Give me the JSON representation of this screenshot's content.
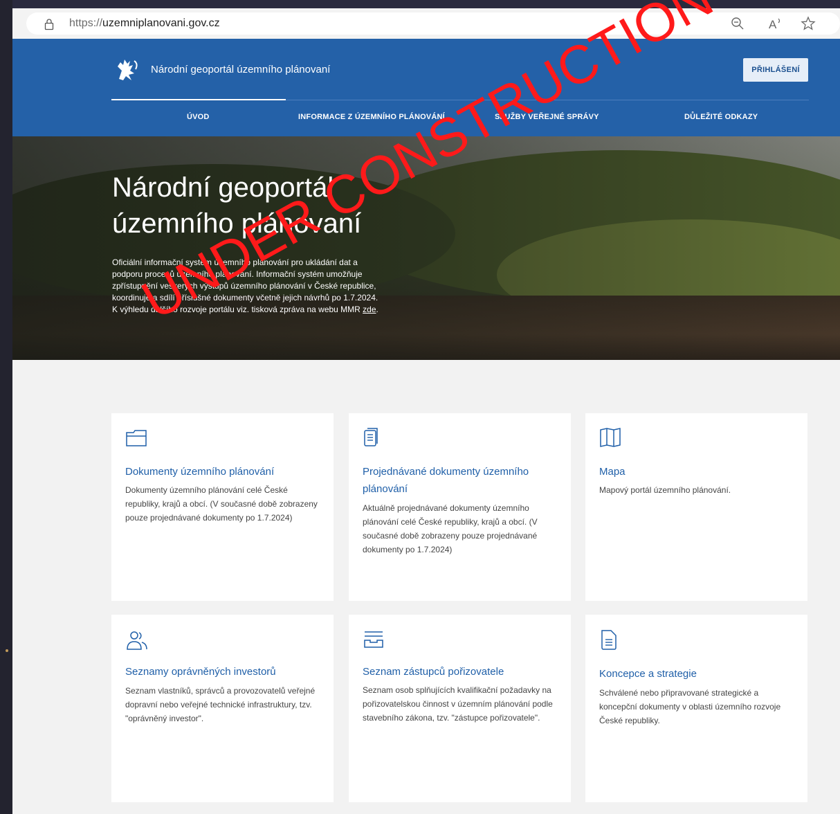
{
  "browser": {
    "url_scheme": "https://",
    "url_host": "uzemniplanovani.gov.cz",
    "icons": [
      "lock-icon",
      "zoom-out-icon",
      "read-aloud-icon",
      "favorite-star-icon"
    ]
  },
  "header": {
    "site_title": "Národní geoportál územního plánovaní",
    "login_label": "PŘIHLÁŠENÍ",
    "nav": [
      {
        "label": "ÚVOD",
        "active": true
      },
      {
        "label": "INFORMACE Z ÚZEMNÍHO PLÁNOVÁNÍ",
        "active": false
      },
      {
        "label": "SLUŽBY VEŘEJNÉ SPRÁVY",
        "active": false
      },
      {
        "label": "DŮLEŽITÉ ODKAZY",
        "active": false
      }
    ],
    "brand_color": "#2461a8"
  },
  "hero": {
    "title_line1": "Národní geoportál",
    "title_line2": "územního plánovaní",
    "text_line1": "Oficiální informační systém územního plánování pro ukládání dat a",
    "text_line2": "podporu procesů územního plánování. Informační systém umožňuje",
    "text_line3": "zpřístupnění veškerých výstupů územního plánování v České republice,",
    "text_line4": "koordinuje a sdílí příslušné dokumenty včetně jejich návrhů po 1.7.2024.",
    "text_line5_prefix": "K výhledu dalšího rozvoje portálu viz. tisková zpráva na webu MMR ",
    "text_link": "zde",
    "text_line5_suffix": "."
  },
  "cards": [
    {
      "icon": "folder-icon",
      "title": "Dokumenty územního plánování",
      "description": "Dokumenty územního plánování celé České republiky, krajů a obcí. (V současné době zobrazeny pouze projednávané dokumenty po 1.7.2024)"
    },
    {
      "icon": "document-list-icon",
      "title": "Projednávané dokumenty územního plánování",
      "description": "Aktuálně projednávané dokumenty územního plánování celé České republiky, krajů a obcí. (V současné době zobrazeny pouze projednávané dokumenty po 1.7.2024)"
    },
    {
      "icon": "map-icon",
      "title": "Mapa",
      "description": "Mapový portál územního plánování."
    },
    {
      "icon": "users-icon",
      "title": "Seznamy oprávněných investorů",
      "description": "Seznam vlastníků, správců a provozovatelů veřejné dopravní nebo veřejné technické infrastruktury, tzv. \"oprávněný investor\"."
    },
    {
      "icon": "inbox-icon",
      "title": "Seznam zástupců pořizovatele",
      "description": "Seznam osob splňujících kvalifikační požadavky na pořizovatelskou činnost v územním plánování podle stavebního zákona, tzv. \"zástupce pořizovatele\"."
    },
    {
      "icon": "document-text-icon",
      "title": "Koncepce a strategie",
      "description": "Schválené nebo připravované strategické a koncepční dokumenty v oblasti územního rozvoje České republiky."
    }
  ],
  "watermark": {
    "text": "UNDER CONSTRUCTION",
    "color": "#ff1a1a"
  }
}
